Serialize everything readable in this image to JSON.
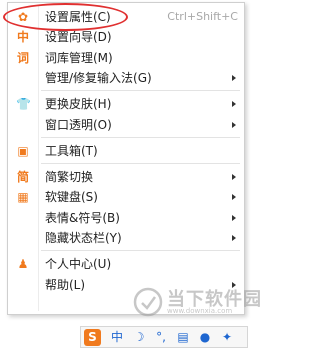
{
  "menu": {
    "items": [
      {
        "icon": "gear-icon",
        "icon_glyph": "✿",
        "label": "设置属性(C)",
        "shortcut": "Ctrl+Shift+C",
        "submenu": false
      },
      {
        "icon": "zhong-icon",
        "icon_glyph": "中",
        "label": "设置向导(D)",
        "shortcut": "",
        "submenu": false
      },
      {
        "icon": "ci-icon",
        "icon_glyph": "词",
        "label": "词库管理(M)",
        "shortcut": "",
        "submenu": false
      },
      {
        "icon": "",
        "icon_glyph": "",
        "label": "管理/修复输入法(G)",
        "shortcut": "",
        "submenu": true
      },
      {
        "icon": "shirt-icon",
        "icon_glyph": "👕",
        "label": "更换皮肤(H)",
        "shortcut": "",
        "submenu": true
      },
      {
        "icon": "",
        "icon_glyph": "",
        "label": "窗口透明(O)",
        "shortcut": "",
        "submenu": true
      },
      {
        "icon": "toolbox-icon",
        "icon_glyph": "▣",
        "label": "工具箱(T)",
        "shortcut": "",
        "submenu": false
      },
      {
        "icon": "jian-icon",
        "icon_glyph": "简",
        "label": "简繁切换",
        "shortcut": "",
        "submenu": true
      },
      {
        "icon": "keyboard-icon",
        "icon_glyph": "▦",
        "label": "软键盘(S)",
        "shortcut": "",
        "submenu": true
      },
      {
        "icon": "",
        "icon_glyph": "",
        "label": "表情&符号(B)",
        "shortcut": "",
        "submenu": true
      },
      {
        "icon": "",
        "icon_glyph": "",
        "label": "隐藏状态栏(Y)",
        "shortcut": "",
        "submenu": true
      },
      {
        "icon": "user-icon",
        "icon_glyph": "♟",
        "label": "个人中心(U)",
        "shortcut": "",
        "submenu": false
      },
      {
        "icon": "",
        "icon_glyph": "",
        "label": "帮助(L)",
        "shortcut": "",
        "submenu": true
      }
    ]
  },
  "watermark": {
    "title": "当下软件园",
    "subtitle": "www.downxia.com"
  },
  "statusbar": {
    "logo_glyph": "S",
    "items": [
      {
        "name": "zhong-icon",
        "glyph": "中",
        "color": "#1e66d0"
      },
      {
        "name": "moon-icon",
        "glyph": "☽",
        "color": "#1e66d0"
      },
      {
        "name": "punct-icon",
        "glyph": "°,",
        "color": "#1e66d0"
      },
      {
        "name": "keyboard-icon",
        "glyph": "▤",
        "color": "#1e66d0"
      },
      {
        "name": "user-icon",
        "glyph": "●",
        "color": "#1e66d0"
      },
      {
        "name": "wrench-icon",
        "glyph": "✦",
        "color": "#1e66d0"
      }
    ]
  },
  "colors": {
    "accent": "#f07a1e",
    "highlight_ring": "#e03030",
    "status_blue": "#1e66d0"
  }
}
